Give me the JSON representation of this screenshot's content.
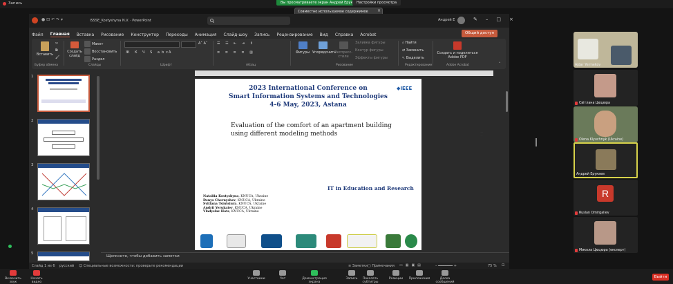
{
  "zoom": {
    "recording_label": "Запись",
    "view_banner": "Вы просматриваете экран Андрей Ерукаев",
    "view_options": "Настройки просмотра",
    "tooltip_text": "Совместно используемое содержимое вписано в ваш экран. Для просмотра исходного размера нажмите в меню \"Original size\" (Исходный...",
    "bottom_bar": [
      {
        "label": "Включить звук",
        "icon": "mic-muted-icon"
      },
      {
        "label": "Начать видео",
        "icon": "video-off-icon"
      },
      {
        "label": "Участники",
        "icon": "participants-icon"
      },
      {
        "label": "Чат",
        "icon": "chat-icon"
      },
      {
        "label": "Демонстрация экрана",
        "icon": "share-screen-icon"
      },
      {
        "label": "Запись",
        "icon": "record-icon"
      },
      {
        "label": "Показать субтитры",
        "icon": "captions-icon"
      },
      {
        "label": "Реакции",
        "icon": "reactions-icon"
      },
      {
        "label": "Приложения",
        "icon": "apps-icon"
      },
      {
        "label": "Доска сообщений",
        "icon": "whiteboard-icon"
      }
    ],
    "end_label": "Выйти"
  },
  "ppt": {
    "doc_title": "ISSSE_Kostyshyna N.V. · PowerPoint",
    "user_name": "Андрей Е",
    "menu": [
      "Файл",
      "Главная",
      "Вставка",
      "Рисование",
      "Конструктор",
      "Переходы",
      "Анимация",
      "Слайд-шоу",
      "Запись",
      "Рецензирование",
      "Вид",
      "Справка",
      "Acrobat"
    ],
    "active_menu_index": 1,
    "share_label": "Общий доступ",
    "ribbon": {
      "paste": "Вставить",
      "create_slide": "Создать слайд",
      "layout": "Макет",
      "reset": "Восстановить",
      "section": "Раздел",
      "shapes": "Фигуры",
      "arrange": "Упорядочить",
      "express_styles": "Экспресс-стили",
      "fill": "Заливка фигуры",
      "outline": "Контур фигуры",
      "effects": "Эффекты фигуры",
      "find": "Найти",
      "replace": "Заменить",
      "select": "Выделить",
      "create_pdf": "Создать и поделиться Adobe PDF",
      "groups": [
        "Буфер обмена",
        "Слайды",
        "Шрифт",
        "Абзац",
        "Рисование",
        "Редактирование",
        "Adobe Acrobat"
      ]
    },
    "thumbnails": [
      {
        "num": "1"
      },
      {
        "num": "2"
      },
      {
        "num": "3"
      },
      {
        "num": "4"
      },
      {
        "num": "5"
      }
    ],
    "slide": {
      "conf_title": [
        "2023 International Conference on",
        "Smart Information Systems and Technologies",
        "4-6 May, 2023, Astana"
      ],
      "ieee": "IEEE",
      "paper_title": [
        "Evaluation of the comfort of an apartment building",
        "using different modeling methods"
      ],
      "track": "IT in Education and Research",
      "authors": [
        {
          "name": "Nataliia Kostyshyna",
          "aff": ", KNUCA, Ukraine"
        },
        {
          "name": "Denys Chernyshev",
          "aff": ", KNUCA, Ukraine"
        },
        {
          "name": "Svitlana Tsiutsiura",
          "aff": ", KNUCA, Ukraine"
        },
        {
          "name": "Andrii Yerukaiev",
          "aff": ", KNUCA, Ukraine"
        },
        {
          "name": "Vladyslav Hots",
          "aff": ", KNUCA, Ukraine"
        }
      ]
    },
    "notes_placeholder": "Щелкните, чтобы добавить заметки",
    "status": {
      "slide_of": "Слайд 1 из 6",
      "language": "русский",
      "accessibility": "Специальные возможности: проверьте рекомендации",
      "notes": "Заметки",
      "comments": "Примечания",
      "zoom": "75 %"
    }
  },
  "participants": [
    {
      "name": "Ajdar Yermekov"
    },
    {
      "name": "Світлана Цюцюра"
    },
    {
      "name": "Olena Klyuchnyk (Ukraine)"
    },
    {
      "name": "Андрей Ерукаев"
    },
    {
      "name": "Ruslan Omirgaliev",
      "initial": "R"
    },
    {
      "name": "Микола Цюцюра (експерт)"
    }
  ]
}
